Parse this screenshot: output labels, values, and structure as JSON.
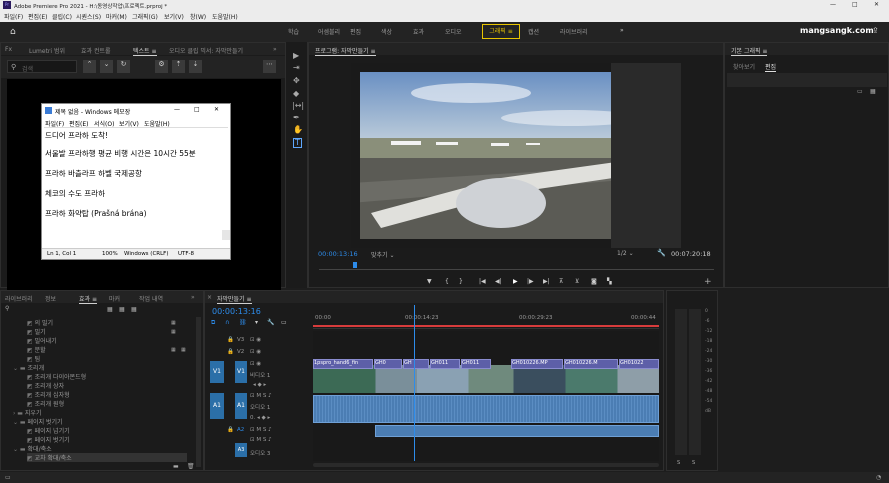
{
  "window": {
    "title": "Adobe Premiere Pro 2021 - H:\\동영상작업\\프로젝트.prproj *",
    "controls": [
      "—",
      "□",
      "✕"
    ]
  },
  "menu": [
    "파일(F)",
    "편집(E)",
    "클립(C)",
    "시퀀스(S)",
    "마커(M)",
    "그래픽(G)",
    "보기(V)",
    "창(W)",
    "도움말(H)"
  ],
  "workspaces": [
    "학습",
    "어셈블리",
    "편집",
    "색상",
    "효과",
    "오디오",
    "그래픽",
    "캡션",
    "라이브러리"
  ],
  "active_workspace": "그래픽",
  "brand": "mangsangk.com",
  "source_panel": {
    "tabs": [
      "Lumetri 범위",
      "효과 컨트롤",
      "텍스트",
      "오디오 클립 믹서: 자막만들기"
    ],
    "active_tab": "텍스트",
    "search_placeholder": "검색"
  },
  "notepad": {
    "title": "제목 없음 - Windows 메모장",
    "menu": [
      "파일(F)",
      "편집(E)",
      "서식(O)",
      "보기(V)",
      "도움말(H)"
    ],
    "lines": [
      "드디어 프라하 도착!",
      "서울발 프라하행 평균 비행 시간은 10시간 55분",
      "프라하 바츨라프 하벨 국제공항",
      "체코의 수도 프라하",
      "프라하 화약탑 (Prašná brána)"
    ],
    "status": [
      "Ln 1, Col 1",
      "100%",
      "Windows (CRLF)",
      "UTF-8"
    ]
  },
  "program_monitor": {
    "title": "프로그램: 자막만들기",
    "timecode": "00:00:13:16",
    "fit": "맞추기",
    "resolution": "1/2",
    "duration": "00:07:20:18"
  },
  "essential_graphics": {
    "title": "기본 그래픽",
    "tabs": [
      "찾아보기",
      "편집"
    ],
    "active_tab": "편집"
  },
  "project_panel": {
    "tabs": [
      "라이브러리",
      "정보",
      "효과",
      "마커",
      "작업 내역"
    ],
    "active_tab": "효과",
    "items": [
      {
        "label": "의 밀기",
        "indent": 2,
        "type": "fx"
      },
      {
        "label": "밀기",
        "indent": 2,
        "type": "fx"
      },
      {
        "label": "밀어내기",
        "indent": 2,
        "type": "fx"
      },
      {
        "label": "분할",
        "indent": 2,
        "type": "fx"
      },
      {
        "label": "팀",
        "indent": 2,
        "type": "fx"
      },
      {
        "label": "조리개",
        "indent": 1,
        "type": "folder"
      },
      {
        "label": "조리개 다이아몬드형",
        "indent": 2,
        "type": "fx"
      },
      {
        "label": "조리개 상자",
        "indent": 2,
        "type": "fx"
      },
      {
        "label": "조리개 십자형",
        "indent": 2,
        "type": "fx"
      },
      {
        "label": "조리개 원형",
        "indent": 2,
        "type": "fx"
      },
      {
        "label": "지우기",
        "indent": 1,
        "type": "folder"
      },
      {
        "label": "페이지 벗기기",
        "indent": 1,
        "type": "folder"
      },
      {
        "label": "페이지 넘기기",
        "indent": 2,
        "type": "fx"
      },
      {
        "label": "페이지 벗기기",
        "indent": 2,
        "type": "fx"
      },
      {
        "label": "확대/축소",
        "indent": 1,
        "type": "folder"
      },
      {
        "label": "교차 확대/축소",
        "indent": 2,
        "type": "fx"
      }
    ]
  },
  "timeline": {
    "title": "자막만들기",
    "timecode": "00:00:13:16",
    "ruler": [
      "00:00",
      "00:00:14:23",
      "00:00:29:23",
      "00:00:44"
    ],
    "tracks": {
      "video": [
        "V3",
        "V2",
        "V1"
      ],
      "audio": [
        "A1",
        "A2",
        "A3"
      ],
      "v1_name": "비디오 1",
      "a1_name": "오디오 1",
      "a3_name": "오디오 3"
    },
    "clips": [
      "1pspro_hand6_fin",
      "GH0",
      "GH",
      "GH011",
      "GH011",
      "GH010226.MP",
      "GH010226.M",
      "GH01022"
    ]
  },
  "meter": [
    "0",
    "-6",
    "-12",
    "-18",
    "-24",
    "-30",
    "-36",
    "-42",
    "-48",
    "-54",
    "dB"
  ],
  "colors": {
    "accent": "#2d8ceb",
    "highlight": "#e8c400",
    "clip_video": "#5d5fa8",
    "clip_audio": "#4b7db3",
    "playhead": "#2d8ceb"
  }
}
